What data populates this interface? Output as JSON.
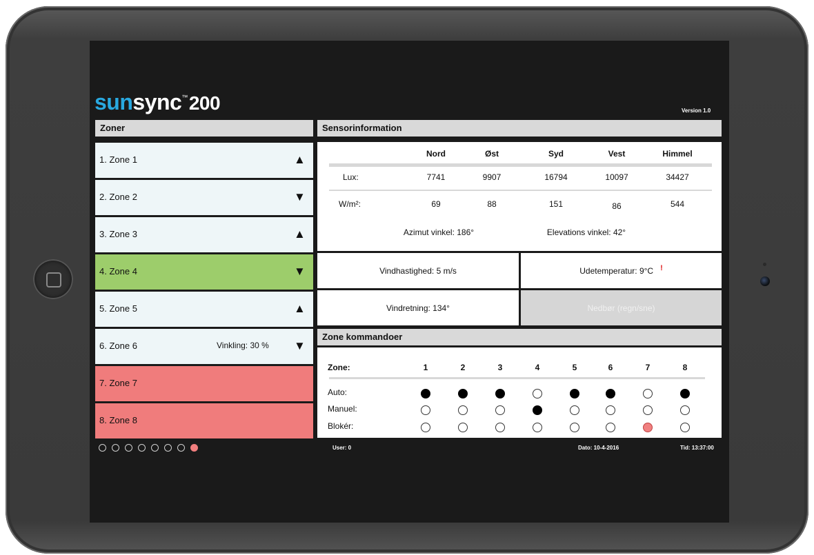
{
  "brand": {
    "sun": "sun",
    "sync": "sync",
    "tm": "™",
    "model": "200",
    "version": "Version 1.0"
  },
  "zones_panel": {
    "header": "Zoner",
    "zones": [
      {
        "label": "1. Zone 1",
        "arrow": "▲",
        "extra": "",
        "state": "light"
      },
      {
        "label": "2. Zone 2",
        "arrow": "▼",
        "extra": "",
        "state": "light"
      },
      {
        "label": "3. Zone 3",
        "arrow": "▲",
        "extra": "",
        "state": "light"
      },
      {
        "label": "4. Zone 4",
        "arrow": "▼",
        "extra": "",
        "state": "green"
      },
      {
        "label": "5. Zone 5",
        "arrow": "▲",
        "extra": "",
        "state": "light"
      },
      {
        "label": "6. Zone 6",
        "arrow": "▼",
        "extra": "Vinkling: 30 %",
        "state": "light"
      },
      {
        "label": "7. Zone 7",
        "arrow": "",
        "extra": "",
        "state": "red"
      },
      {
        "label": "8. Zone 8",
        "arrow": "",
        "extra": "",
        "state": "red"
      }
    ],
    "page_dots": {
      "count": 8,
      "active_index": 7
    }
  },
  "sensor": {
    "header": "Sensorinformation",
    "columns": [
      "Nord",
      "Øst",
      "Syd",
      "Vest",
      "Himmel"
    ],
    "rows": [
      {
        "label": "Lux:",
        "values": [
          "7741",
          "9907",
          "16794",
          "10097",
          "34427"
        ]
      },
      {
        "label": "W/m²:",
        "values": [
          "69",
          "88",
          "151",
          "86",
          "544"
        ]
      }
    ],
    "azimut": "Azimut vinkel: 186°",
    "elevation": "Elevations vinkel: 42°"
  },
  "weather": {
    "wind_speed": "Vindhastighed: 5 m/s",
    "temperature": "Udetemperatur: 9°C",
    "temperature_mark": "!",
    "wind_direction": "Vindretning: 134°",
    "precipitation": "Nedbør (regn/sne)"
  },
  "commands": {
    "header": "Zone kommandoer",
    "zone_label": "Zone:",
    "zone_numbers": [
      "1",
      "2",
      "3",
      "4",
      "5",
      "6",
      "7",
      "8"
    ],
    "rows": [
      {
        "label": "Auto:",
        "states": [
          "on",
          "on",
          "on",
          "off",
          "on",
          "on",
          "off",
          "on"
        ]
      },
      {
        "label": "Manuel:",
        "states": [
          "off",
          "off",
          "off",
          "on",
          "off",
          "off",
          "off",
          "off"
        ]
      },
      {
        "label": "Blokér:",
        "states": [
          "off",
          "off",
          "off",
          "off",
          "off",
          "off",
          "red",
          "off"
        ]
      }
    ]
  },
  "footer": {
    "user": "User: 0",
    "date": "Dato: 10-4-2016",
    "time": "Tid: 13:37:00"
  },
  "colors": {
    "accent": "#29a9e0",
    "zone_active": "#9dcd6b",
    "zone_blocked": "#f07c7c",
    "zone_default": "#eef6f8"
  }
}
